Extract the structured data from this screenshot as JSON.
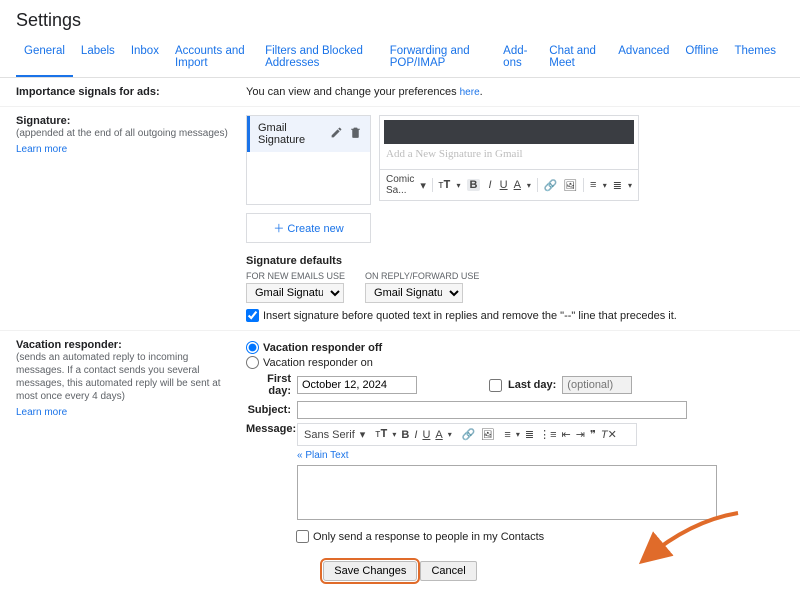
{
  "page_title": "Settings",
  "tabs": [
    "General",
    "Labels",
    "Inbox",
    "Accounts and Import",
    "Filters and Blocked Addresses",
    "Forwarding and POP/IMAP",
    "Add-ons",
    "Chat and Meet",
    "Advanced",
    "Offline",
    "Themes"
  ],
  "ads": {
    "label": "Importance signals for ads:",
    "text_pre": "You can view and change your preferences ",
    "link": "here",
    "text_post": "."
  },
  "signature": {
    "label": "Signature:",
    "sub": "(appended at the end of all outgoing messages)",
    "learn_more": "Learn more",
    "item_name": "Gmail Signature",
    "preview_text": "Add a New Signature in Gmail",
    "font": "Comic Sa...",
    "create_new": "Create new",
    "defaults_head": "Signature defaults",
    "for_new": "FOR NEW EMAILS USE",
    "on_reply": "ON REPLY/FORWARD USE",
    "sel_value": "Gmail Signature",
    "insert_chk": "Insert signature before quoted text in replies and remove the \"--\" line that precedes it."
  },
  "vacation": {
    "label": "Vacation responder:",
    "sub": "(sends an automated reply to incoming messages. If a contact sends you several messages, this automated reply will be sent at most once every 4 days)",
    "learn_more": "Learn more",
    "off": "Vacation responder off",
    "on": "Vacation responder on",
    "first_day_lbl": "First day:",
    "first_day_val": "October 12, 2024",
    "last_day_lbl": "Last day:",
    "last_day_ph": "(optional)",
    "subject_lbl": "Subject:",
    "message_lbl": "Message:",
    "font": "Sans Serif",
    "plain": "« Plain Text",
    "contacts_only": "Only send a response to people in my Contacts"
  },
  "footer": {
    "save": "Save Changes",
    "cancel": "Cancel"
  }
}
